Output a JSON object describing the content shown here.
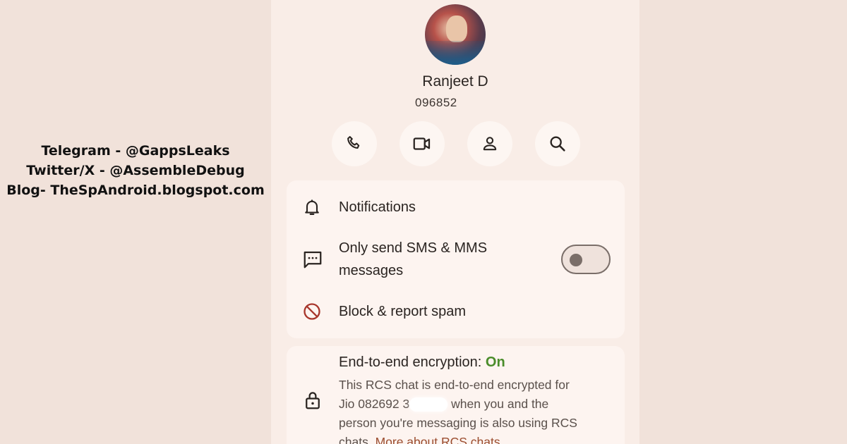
{
  "promo": {
    "telegram": "Telegram - @GappsLeaks",
    "twitter": "Twitter/X - @AssembleDebug",
    "blog": "Blog- TheSpAndroid.blogspot.com"
  },
  "contact": {
    "name": "Ranjeet D",
    "phone": "096852"
  },
  "actions": [
    "call-icon",
    "video-call-icon",
    "contact-info-icon",
    "search-icon"
  ],
  "settings": {
    "notifications_label": "Notifications",
    "sms_only_label_line1": "Only send SMS & MMS",
    "sms_only_label_line2": "messages",
    "sms_only_enabled": false,
    "block_label": "Block & report spam"
  },
  "encryption": {
    "title": "End-to-end encryption:",
    "status": "On",
    "body_part1": "This RCS chat is end-to-end encrypted for",
    "body_part2": "Jio 082692 3",
    "body_part3": "when you and the",
    "body_part4": "person you're messaging is also using RCS",
    "body_part5": "chats.",
    "link": "More about RCS chats"
  },
  "colors": {
    "background": "#f1e2da",
    "surface": "#f9ede7",
    "spam_red": "#a8362c",
    "encryption_on_green": "#4a8c2a",
    "link": "#9b4d2f"
  }
}
